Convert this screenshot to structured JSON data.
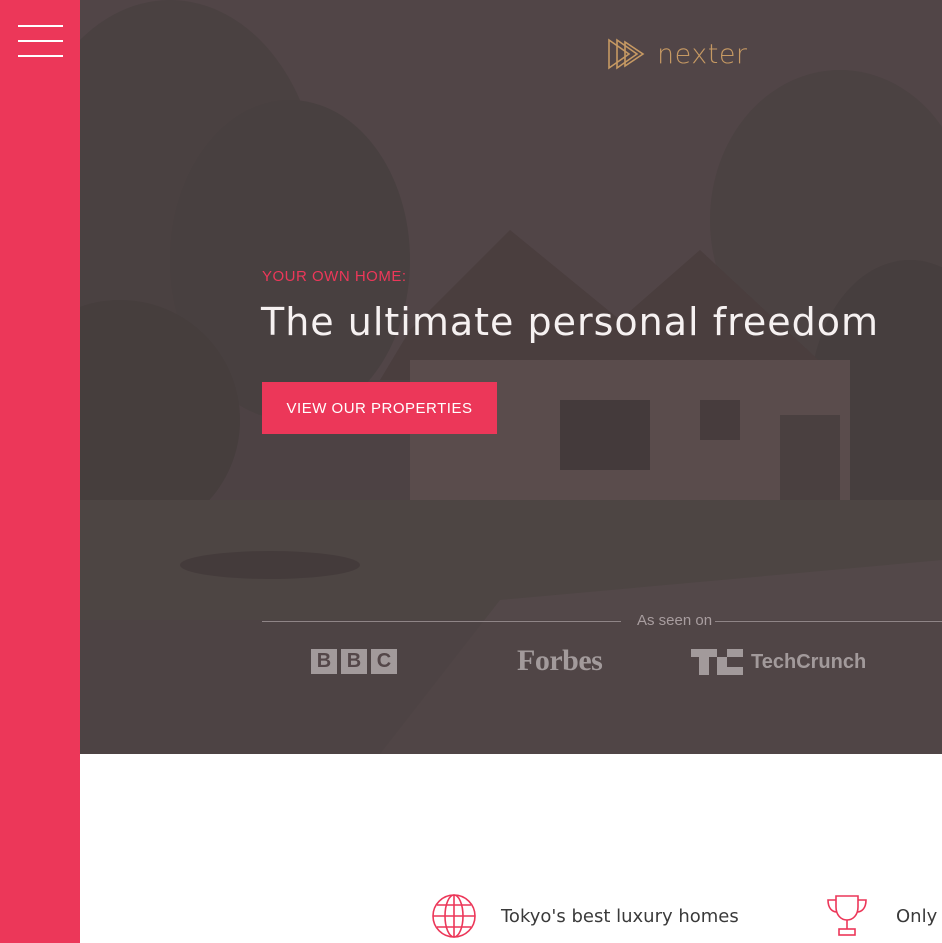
{
  "brand": {
    "name": "nexter",
    "color": "#c69963",
    "icon": "triangle-play-logo-icon"
  },
  "sidebar": {
    "menu_icon": "hamburger-menu-icon",
    "color": "#ec3759"
  },
  "hero": {
    "eyebrow": "YOUR OWN HOME:",
    "headline": "The ultimate personal freedom",
    "cta_label": "VIEW OUR PROPERTIES",
    "seen_on_label": "As seen on",
    "press_logos": {
      "bbc": [
        "B",
        "B",
        "C"
      ],
      "forbes": "Forbes",
      "techcrunch": "TechCrunch"
    }
  },
  "features": [
    {
      "icon": "globe-icon",
      "label": "Tokyo's best luxury homes"
    },
    {
      "icon": "trophy-icon",
      "label": "Only"
    }
  ],
  "colors": {
    "accent": "#ec3759",
    "gold": "#c69963",
    "hero_overlay": "#4f4446"
  }
}
